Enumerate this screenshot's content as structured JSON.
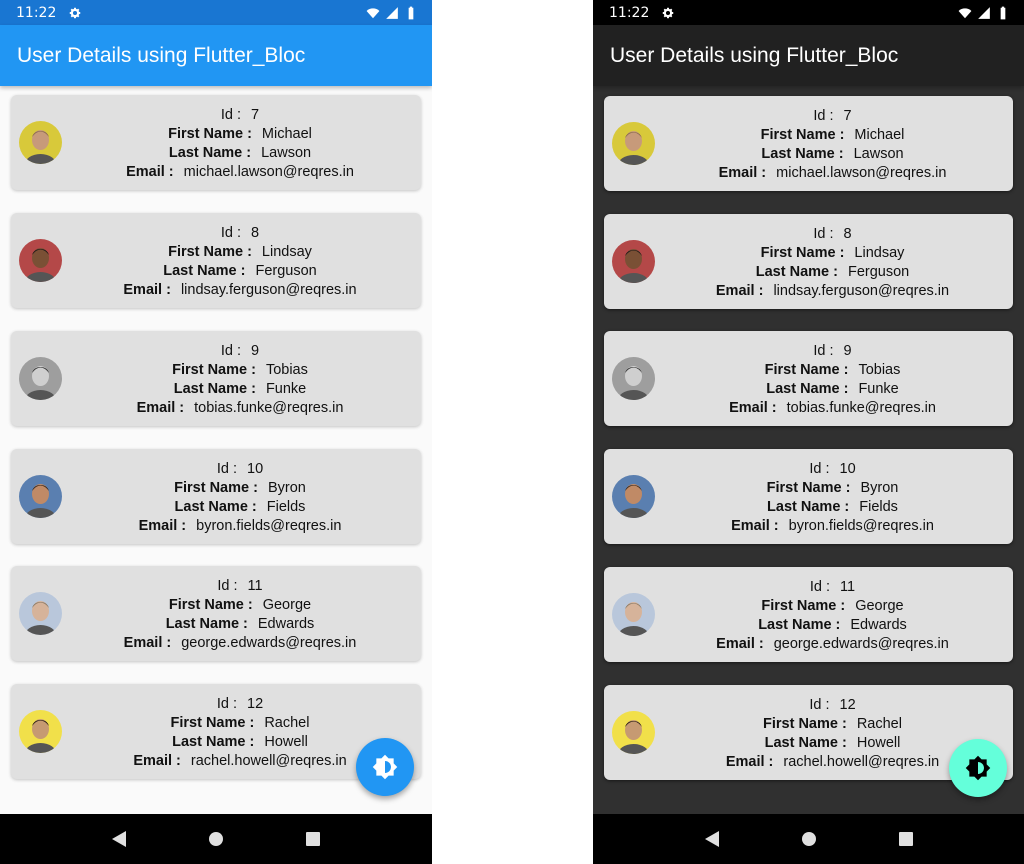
{
  "status_bar": {
    "time": "11:22",
    "icons": [
      "gear-icon",
      "wifi-icon",
      "signal-icon",
      "battery-icon"
    ]
  },
  "app_bar": {
    "title": "User Details using Flutter_Bloc"
  },
  "labels": {
    "id": "Id :",
    "first_name": "First Name :",
    "last_name": "Last Name :",
    "email": "Email :"
  },
  "users": [
    {
      "id": "7",
      "first_name": "Michael",
      "last_name": "Lawson",
      "email": "michael.lawson@reqres.in",
      "avatar_bg": "#d8c93a",
      "skin": "#c79a7a",
      "hair": "#8a6a50"
    },
    {
      "id": "8",
      "first_name": "Lindsay",
      "last_name": "Ferguson",
      "email": "lindsay.ferguson@reqres.in",
      "avatar_bg": "#b44848",
      "skin": "#7a5035",
      "hair": "#1f1a18"
    },
    {
      "id": "9",
      "first_name": "Tobias",
      "last_name": "Funke",
      "email": "tobias.funke@reqres.in",
      "avatar_bg": "#9e9e9e",
      "skin": "#cfcfcf",
      "hair": "#333333"
    },
    {
      "id": "10",
      "first_name": "Byron",
      "last_name": "Fields",
      "email": "byron.fields@reqres.in",
      "avatar_bg": "#5a7fb0",
      "skin": "#c08a66",
      "hair": "#3a2a20"
    },
    {
      "id": "11",
      "first_name": "George",
      "last_name": "Edwards",
      "email": "george.edwards@reqres.in",
      "avatar_bg": "#b9c7db",
      "skin": "#d6b39a",
      "hair": "#8a7a66"
    },
    {
      "id": "12",
      "first_name": "Rachel",
      "last_name": "Howell",
      "email": "rachel.howell@reqres.in",
      "avatar_bg": "#f1e04a",
      "skin": "#c69a72",
      "hair": "#2a1e14"
    }
  ],
  "fab": {
    "icon": "brightness-toggle-icon"
  },
  "nav_bar": {
    "icons": [
      "back-icon",
      "home-icon",
      "recents-icon"
    ]
  },
  "colors": {
    "light_appbar": "#2196f3",
    "light_status": "#1976d2",
    "dark_appbar": "#212121",
    "dark_bg": "#303030",
    "card": "#e0e0e0",
    "light_fab": "#2196f3",
    "dark_fab": "#64ffda"
  }
}
